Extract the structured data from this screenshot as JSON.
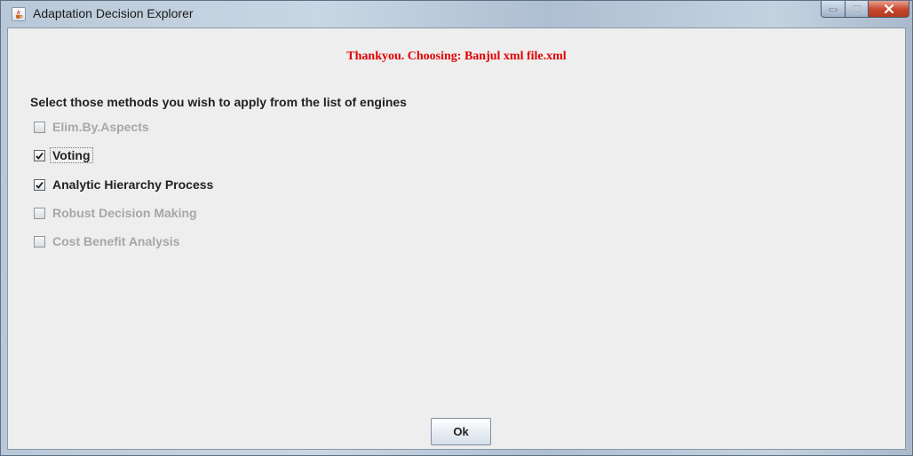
{
  "window": {
    "title": "Adaptation Decision Explorer",
    "icon": "java-cup-icon"
  },
  "status_message": "Thankyou. Choosing: Banjul xml file.xml",
  "instruction": "Select those methods you wish to apply from the list of engines",
  "methods": [
    {
      "label": "Elim.By.Aspects",
      "checked": false,
      "enabled": false
    },
    {
      "label": "Voting",
      "checked": true,
      "enabled": true,
      "focused": true
    },
    {
      "label": "Analytic Hierarchy Process",
      "checked": true,
      "enabled": true
    },
    {
      "label": "Robust Decision Making",
      "checked": false,
      "enabled": false
    },
    {
      "label": "Cost Benefit Analysis",
      "checked": false,
      "enabled": false
    }
  ],
  "ok_button": {
    "label": "Ok"
  },
  "colors": {
    "status_message": "#e00000",
    "disabled_text": "#a7a7a7",
    "close_button": "#c8452b"
  }
}
